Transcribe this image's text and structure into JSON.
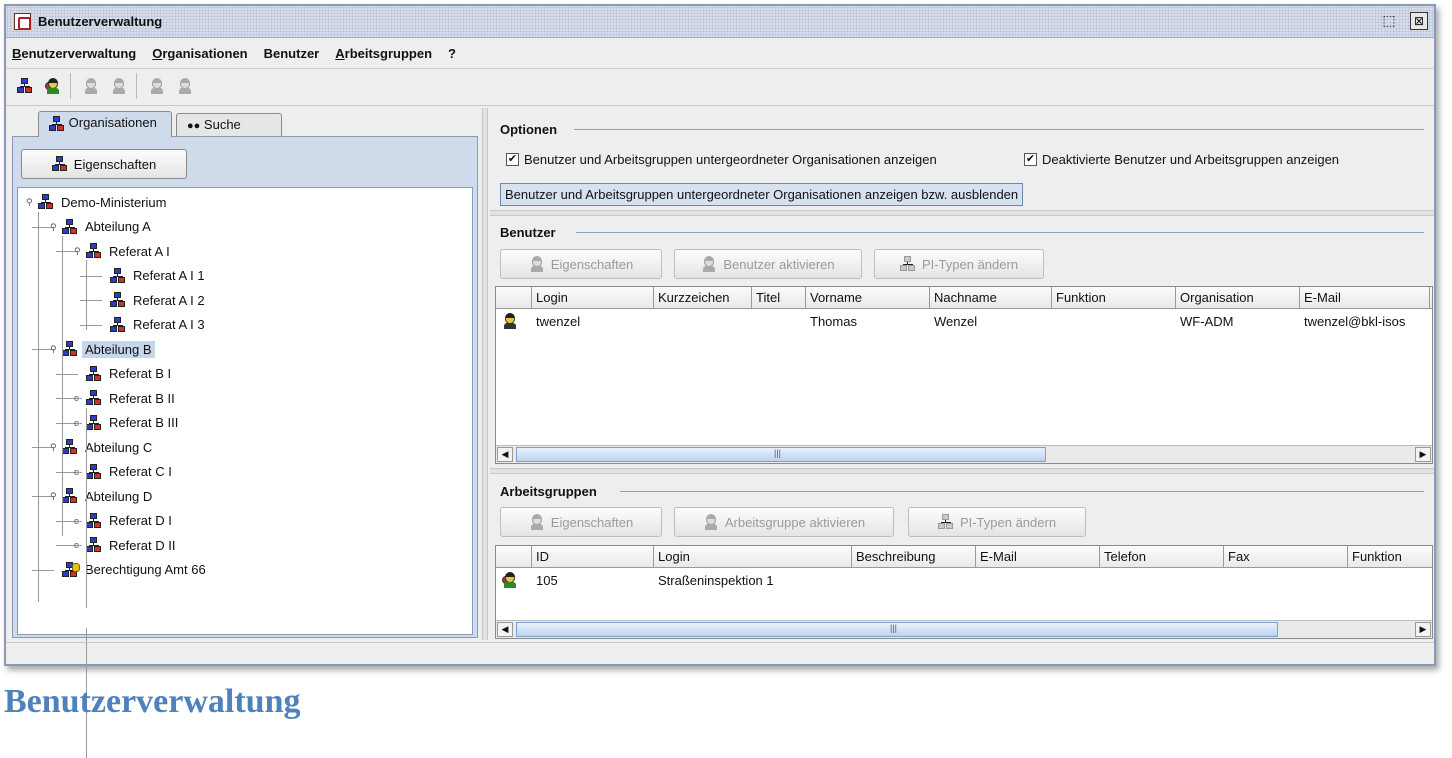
{
  "window": {
    "title": "Benutzerverwaltung",
    "restore_glyph": "⬚",
    "close_glyph": "⊠"
  },
  "menu": [
    "Benutzerverwaltung",
    "Organisationen",
    "Benutzer",
    "Arbeitsgruppen",
    "?"
  ],
  "left": {
    "tabs": [
      "Organisationen",
      "Suche"
    ],
    "properties_button": "Eigenschaften",
    "tree": [
      {
        "label": "Demo-Ministerium",
        "level": 0,
        "icon": "org-icon",
        "toggle": "expanded"
      },
      {
        "label": "Abteilung A",
        "level": 1,
        "icon": "org-icon",
        "toggle": "expanded"
      },
      {
        "label": "Referat A I",
        "level": 2,
        "icon": "org-icon",
        "toggle": "expanded"
      },
      {
        "label": "Referat A I 1",
        "level": 3,
        "icon": "org-icon",
        "toggle": "none"
      },
      {
        "label": "Referat A I 2",
        "level": 3,
        "icon": "org-icon",
        "toggle": "none"
      },
      {
        "label": "Referat A I 3",
        "level": 3,
        "icon": "org-icon",
        "toggle": "none"
      },
      {
        "label": "Abteilung B",
        "level": 1,
        "icon": "org-icon",
        "toggle": "expanded",
        "selected": true
      },
      {
        "label": "Referat B I",
        "level": 2,
        "icon": "org-icon",
        "toggle": "none"
      },
      {
        "label": "Referat B II",
        "level": 2,
        "icon": "org-icon",
        "toggle": "collapsed"
      },
      {
        "label": "Referat B III",
        "level": 2,
        "icon": "org-icon",
        "toggle": "collapsed"
      },
      {
        "label": "Abteilung C",
        "level": 1,
        "icon": "org-icon",
        "toggle": "expanded"
      },
      {
        "label": "Referat C I",
        "level": 2,
        "icon": "org-icon",
        "toggle": "collapsed"
      },
      {
        "label": "Abteilung D",
        "level": 1,
        "icon": "org-icon",
        "toggle": "expanded"
      },
      {
        "label": "Referat D I",
        "level": 2,
        "icon": "org-icon",
        "toggle": "collapsed"
      },
      {
        "label": "Referat D II",
        "level": 2,
        "icon": "org-icon",
        "toggle": "collapsed"
      },
      {
        "label": "Berechtigung Amt 66",
        "level": 1,
        "icon": "org-key-icon",
        "toggle": "none"
      }
    ]
  },
  "options": {
    "title": "Optionen",
    "checkbox1": "Benutzer und Arbeitsgruppen untergeordneter Organisationen anzeigen",
    "checkbox2": "Deaktivierte Benutzer und Arbeitsgruppen anzeigen",
    "check_mark": "✔",
    "tooltip": "Benutzer und Arbeitsgruppen untergeordneter Organisationen anzeigen bzw. ausblenden"
  },
  "users": {
    "title": "Benutzer",
    "buttons": [
      "Eigenschaften",
      "Benutzer aktivieren",
      "PI-Typen ändern"
    ],
    "columns": [
      "Login",
      "Kurzzeichen",
      "Titel",
      "Vorname",
      "Nachname",
      "Funktion",
      "Organisation",
      "E-Mail"
    ],
    "rows": [
      {
        "Login": "twenzel",
        "Kurzzeichen": "",
        "Titel": "",
        "Vorname": "Thomas",
        "Nachname": "Wenzel",
        "Funktion": "",
        "Organisation": "WF-ADM",
        "E-Mail": "twenzel@bkl-isos"
      }
    ]
  },
  "groups": {
    "title": "Arbeitsgruppen",
    "buttons": [
      "Eigenschaften",
      "Arbeitsgruppe aktivieren",
      "PI-Typen ändern"
    ],
    "columns": [
      "ID",
      "Login",
      "Beschreibung",
      "E-Mail",
      "Telefon",
      "Fax",
      "Funktion"
    ],
    "rows": [
      {
        "ID": "105",
        "Login": "Straßeninspektion 1",
        "Beschreibung": "",
        "E-Mail": "",
        "Telefon": "",
        "Fax": "",
        "Funktion": ""
      }
    ]
  },
  "scroll": {
    "left_arrow": "◀",
    "right_arrow": "▶",
    "thumb_grip": "|||"
  },
  "caption": "Benutzerverwaltung"
}
